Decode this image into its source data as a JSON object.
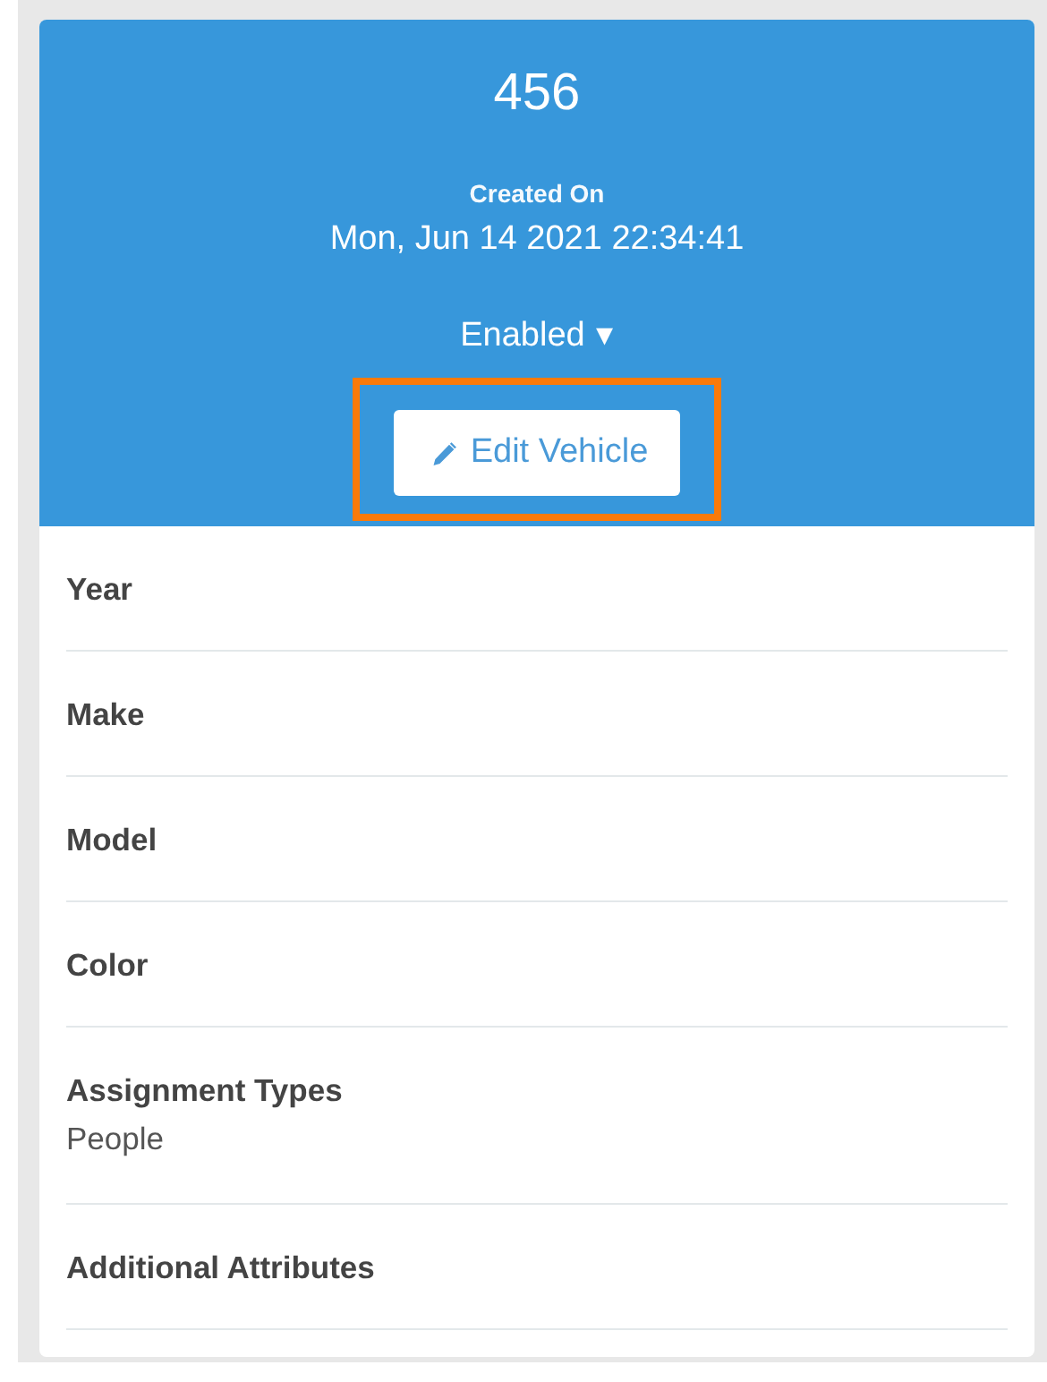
{
  "vehicle": {
    "name": "456",
    "created_label": "Created On",
    "created_at": "Mon, Jun 14 2021 22:34:41",
    "status": "Enabled",
    "status_dropdown": "▾"
  },
  "edit_button": {
    "label": "Edit Vehicle",
    "highlighted": true
  },
  "fields": [
    {
      "label": "Year"
    },
    {
      "label": "Make"
    },
    {
      "label": "Model"
    },
    {
      "label": "Color"
    },
    {
      "label": "Assignment Types",
      "value": "People"
    },
    {
      "label": "Additional Attributes"
    }
  ]
}
